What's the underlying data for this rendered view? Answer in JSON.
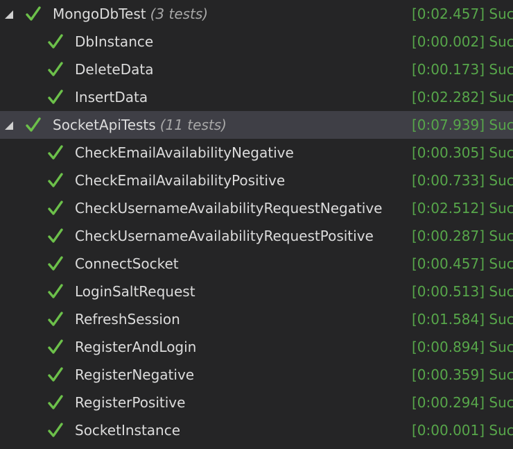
{
  "colors": {
    "background": "#252526",
    "selected_row": "#3f3f46",
    "text": "#dcdcdc",
    "count_text": "#a8a8a8",
    "result_text": "#57a64a",
    "check": "#6cc04a"
  },
  "icons": {
    "expander": "expanded-triangle-icon",
    "status": "check-icon"
  },
  "groups": [
    {
      "name": "MongoDbTest",
      "count": "(3 tests)",
      "result": "[0:02.457] Suc",
      "selected": false,
      "tests": [
        {
          "name": "DbInstance",
          "result": "[0:00.002] Suc"
        },
        {
          "name": "DeleteData",
          "result": "[0:00.173] Suc"
        },
        {
          "name": "InsertData",
          "result": "[0:02.282] Suc"
        }
      ]
    },
    {
      "name": "SocketApiTests",
      "count": "(11 tests)",
      "result": "[0:07.939] Suc",
      "selected": true,
      "tests": [
        {
          "name": "CheckEmailAvailabilityNegative",
          "result": "[0:00.305] Suc"
        },
        {
          "name": "CheckEmailAvailabilityPositive",
          "result": "[0:00.733] Suc"
        },
        {
          "name": "CheckUsernameAvailabilityRequestNegative",
          "result": "[0:02.512] Suc"
        },
        {
          "name": "CheckUsernameAvailabilityRequestPositive",
          "result": "[0:00.287] Suc"
        },
        {
          "name": "ConnectSocket",
          "result": "[0:00.457] Suc"
        },
        {
          "name": "LoginSaltRequest",
          "result": "[0:00.513] Suc"
        },
        {
          "name": "RefreshSession",
          "result": "[0:01.584] Suc"
        },
        {
          "name": "RegisterAndLogin",
          "result": "[0:00.894] Suc"
        },
        {
          "name": "RegisterNegative",
          "result": "[0:00.359] Suc"
        },
        {
          "name": "RegisterPositive",
          "result": "[0:00.294] Suc"
        },
        {
          "name": "SocketInstance",
          "result": "[0:00.001] Suc"
        }
      ]
    }
  ]
}
